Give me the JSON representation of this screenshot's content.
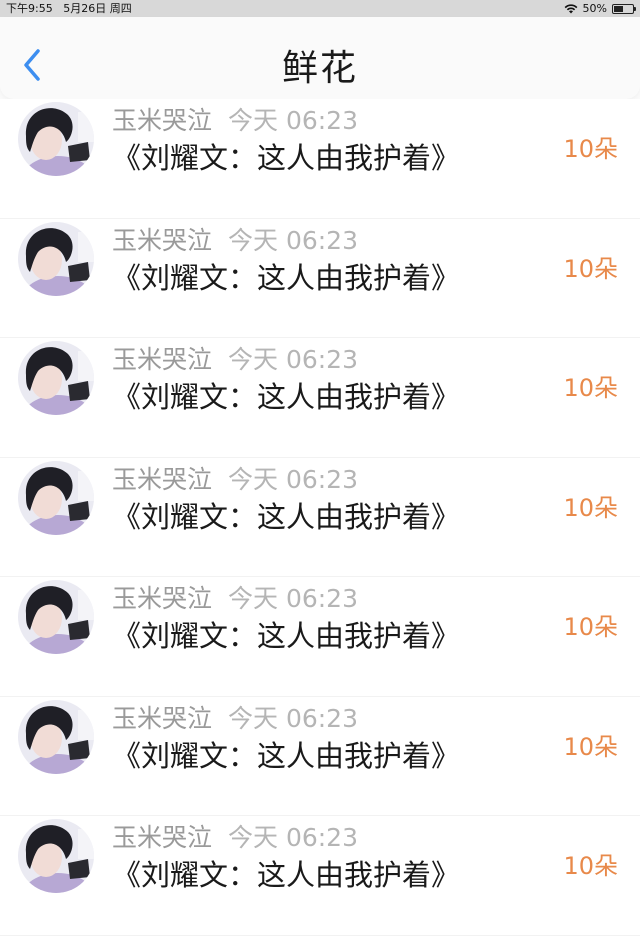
{
  "status_bar": {
    "time": "下午9:55",
    "date": "5月26日 周四",
    "battery": "50%",
    "battery_level": 0.5
  },
  "header": {
    "title": "鲜花",
    "back_icon": "chevron-left-icon",
    "accent_color": "#3d8ef0"
  },
  "items": [
    {
      "name": "玉米哭泣",
      "time": "今天 06:23",
      "title": "《刘耀文：这人由我护着》",
      "count": "10朵"
    },
    {
      "name": "玉米哭泣",
      "time": "今天 06:23",
      "title": "《刘耀文：这人由我护着》",
      "count": "10朵"
    },
    {
      "name": "玉米哭泣",
      "time": "今天 06:23",
      "title": "《刘耀文：这人由我护着》",
      "count": "10朵"
    },
    {
      "name": "玉米哭泣",
      "time": "今天 06:23",
      "title": "《刘耀文：这人由我护着》",
      "count": "10朵"
    },
    {
      "name": "玉米哭泣",
      "time": "今天 06:23",
      "title": "《刘耀文：这人由我护着》",
      "count": "10朵"
    },
    {
      "name": "玉米哭泣",
      "time": "今天 06:23",
      "title": "《刘耀文：这人由我护着》",
      "count": "10朵"
    },
    {
      "name": "玉米哭泣",
      "time": "今天 06:23",
      "title": "《刘耀文：这人由我护着》",
      "count": "10朵"
    }
  ],
  "count_color": "#e8894a"
}
